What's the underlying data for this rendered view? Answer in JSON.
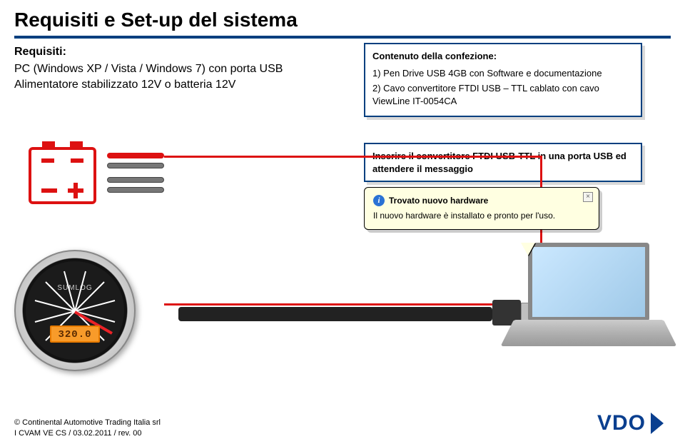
{
  "title": "Requisiti e Set-up del sistema",
  "requirements": {
    "heading": "Requisiti:",
    "line1": "PC (Windows XP / Vista / Windows 7) con porta USB",
    "line2": "Alimentatore stabilizzato 12V o batteria 12V"
  },
  "package": {
    "title": "Contenuto della confezione:",
    "item1": "1) Pen Drive USB 4GB con Software e documentazione",
    "item2": "2) Cavo convertitore FTDI USB – TTL  cablato con cavo ViewLine IT-0054CA"
  },
  "instruction": "Inserire il convertitore FTDI USB-TTL in una porta USB ed attendere il messaggio",
  "tooltip": {
    "title": "Trovato nuovo hardware",
    "body": "Il nuovo hardware è installato e pronto per l'uso.",
    "close": "×",
    "info": "i"
  },
  "gauge": {
    "label": "SUMLOG",
    "lcd": "320.0"
  },
  "footer": {
    "line1": "© Continental Automotive Trading Italia srl",
    "line2": "I CVAM VE CS / 03.02.2011 / rev. 00"
  },
  "logo": "VDO"
}
